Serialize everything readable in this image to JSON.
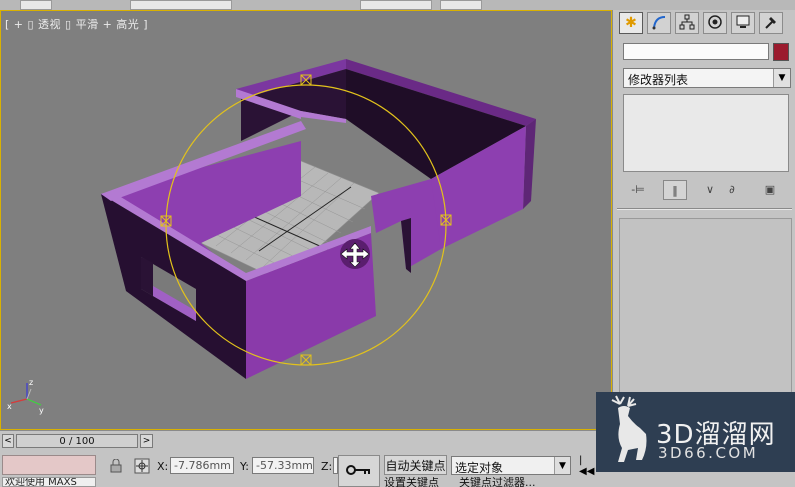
{
  "viewport": {
    "label": "[ + ▯ 透视 ▯ 平滑 + 高光 ]"
  },
  "command_panel": {
    "tabs": [
      {
        "name": "create",
        "icon": "sun-icon"
      },
      {
        "name": "modify",
        "icon": "modify-arc-icon"
      },
      {
        "name": "hierarchy",
        "icon": "hierarchy-icon"
      },
      {
        "name": "motion",
        "icon": "motion-icon"
      },
      {
        "name": "display",
        "icon": "monitor-icon"
      },
      {
        "name": "utilities",
        "icon": "hammer-icon"
      }
    ],
    "object_name": "",
    "object_color": "#9b1b2e",
    "modifier_list_label": "修改器列表"
  },
  "time_slider": {
    "value": "0 / 100",
    "prev": "<",
    "next": ">"
  },
  "status": {
    "message": "欢迎使用 MAXS",
    "x_label": "X:",
    "x_value": "-7.786mm",
    "y_label": "Y:",
    "y_value": "-57.33mm",
    "z_label": "Z:",
    "auto_key": "自动关键点",
    "set_key": "设置关键点",
    "selection_dropdown": "选定对象",
    "key_filters": "关键点过滤器..."
  },
  "watermark": {
    "title": "3D溜溜网",
    "subtitle": "3D66.COM"
  },
  "colors": {
    "viewport_bg": "#7f7f7f",
    "wall_color": "#8a3fa8",
    "gizmo_color": "#e2c21c"
  }
}
